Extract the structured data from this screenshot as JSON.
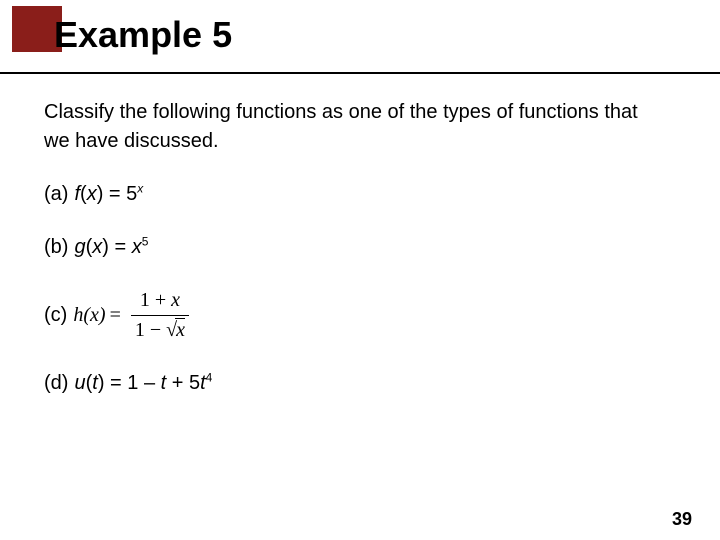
{
  "title": "Example 5",
  "intro": "Classify the following functions as one of the types of functions that we have discussed.",
  "items": {
    "a": {
      "label": "(a)",
      "func": "f",
      "arg": "x",
      "rhs_base": "5",
      "rhs_exp": "x"
    },
    "b": {
      "label": "(b)",
      "func": "g",
      "arg": "x",
      "rhs_base": "x",
      "rhs_exp": "5"
    },
    "c": {
      "label": "(c)",
      "func": "h",
      "arg": "x",
      "num_pre": "1 + ",
      "num_var": "x",
      "den_pre": "1 − ",
      "den_var": "x"
    },
    "d": {
      "label": "(d)",
      "func": "u",
      "arg": "t",
      "rhs_text_pre": "1 – ",
      "rhs_var1": "t",
      "rhs_text_mid": " + 5",
      "rhs_var2": "t",
      "rhs_exp": "4"
    }
  },
  "page_number": "39"
}
